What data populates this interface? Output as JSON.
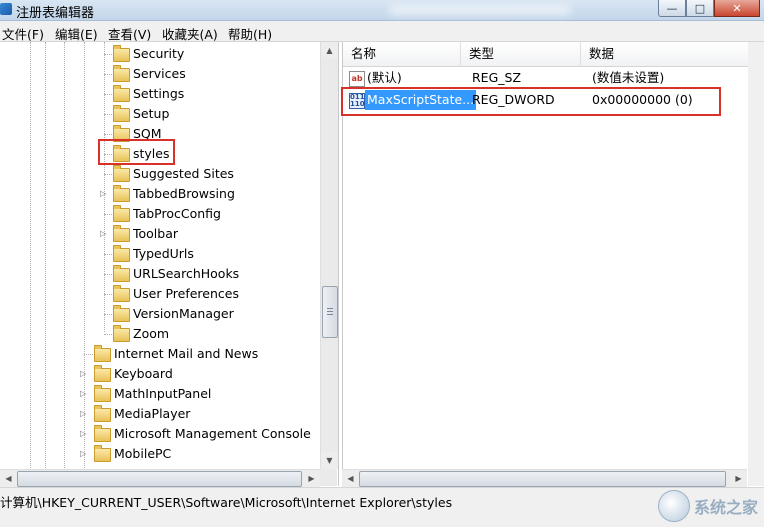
{
  "window": {
    "title": "注册表编辑器",
    "controls": [
      "—",
      "□",
      "✕"
    ]
  },
  "menu": [
    "文件(F)",
    "编辑(E)",
    "查看(V)",
    "收藏夹(A)",
    "帮助(H)"
  ],
  "tree": {
    "sub_items": [
      {
        "label": "Security",
        "expandable": false
      },
      {
        "label": "Services",
        "expandable": false
      },
      {
        "label": "Settings",
        "expandable": false
      },
      {
        "label": "Setup",
        "expandable": false
      },
      {
        "label": "SQM",
        "expandable": false
      },
      {
        "label": "styles",
        "expandable": false,
        "selected": true
      },
      {
        "label": "Suggested Sites",
        "expandable": false
      },
      {
        "label": "TabbedBrowsing",
        "expandable": true
      },
      {
        "label": "TabProcConfig",
        "expandable": false
      },
      {
        "label": "Toolbar",
        "expandable": true
      },
      {
        "label": "TypedUrls",
        "expandable": false
      },
      {
        "label": "URLSearchHooks",
        "expandable": false
      },
      {
        "label": "User Preferences",
        "expandable": false
      },
      {
        "label": "VersionManager",
        "expandable": false
      },
      {
        "label": "Zoom",
        "expandable": false
      }
    ],
    "top_items": [
      {
        "label": "Internet Mail and News",
        "expandable": false
      },
      {
        "label": "Keyboard",
        "expandable": true
      },
      {
        "label": "MathInputPanel",
        "expandable": true
      },
      {
        "label": "MediaPlayer",
        "expandable": true
      },
      {
        "label": "Microsoft Management Console",
        "expandable": true
      },
      {
        "label": "MobilePC",
        "expandable": true
      }
    ]
  },
  "list": {
    "headers": [
      "名称",
      "类型",
      "数据"
    ],
    "rows": [
      {
        "icon": "string-value-icon",
        "name": "(默认)",
        "type": "REG_SZ",
        "data": "(数值未设置)"
      },
      {
        "icon": "dword-value-icon",
        "name": "MaxScriptState...",
        "type": "REG_DWORD",
        "data": "0x00000000 (0)",
        "selected": true
      }
    ]
  },
  "status": {
    "path": "计算机\\HKEY_CURRENT_USER\\Software\\Microsoft\\Internet Explorer\\styles"
  },
  "watermark": {
    "text": "系统之家"
  },
  "colors": {
    "highlight": "#d9302a",
    "selection": "#3399ff"
  }
}
